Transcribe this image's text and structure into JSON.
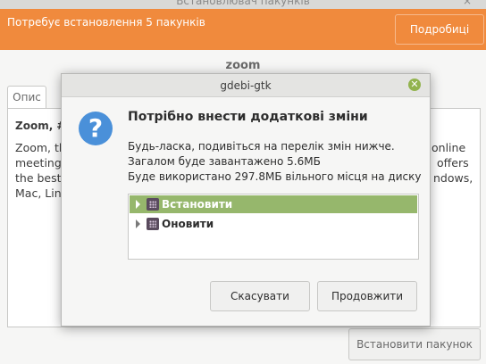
{
  "background": {
    "window_title": "Встановлювач пакунків",
    "close_glyph": "×",
    "banner_text": "Потребує встановлення 5 пакунків",
    "details_button": "Подробиці",
    "package_name": "zoom",
    "tab_description": "Опис",
    "description_title": "Zoom, #",
    "description_lines_left": [
      "Zoom, th",
      "meetings",
      "the best",
      "Mac, Linu"
    ],
    "description_lines_right": [
      "online",
      "offers",
      "ndows,"
    ],
    "install_button": "Встановити пакунок",
    "banner_color": "#f08a3d"
  },
  "dialog": {
    "title": "gdebi-gtk",
    "close_glyph": "✕",
    "icon": "question-icon",
    "icon_glyph": "?",
    "heading": "Потрібно внести додаткові зміни",
    "lines": [
      "Будь-ласка, подивіться на перелік змін нижче.",
      "Загалом буде завантажено 5.6МБ",
      "Буде використано 297.8МБ вільного місця на диску"
    ],
    "changes": [
      {
        "label": "Встановити",
        "selected": true
      },
      {
        "label": "Оновити",
        "selected": false
      }
    ],
    "cancel_button": "Скасувати",
    "continue_button": "Продовжити",
    "selection_color": "#96b76c"
  }
}
